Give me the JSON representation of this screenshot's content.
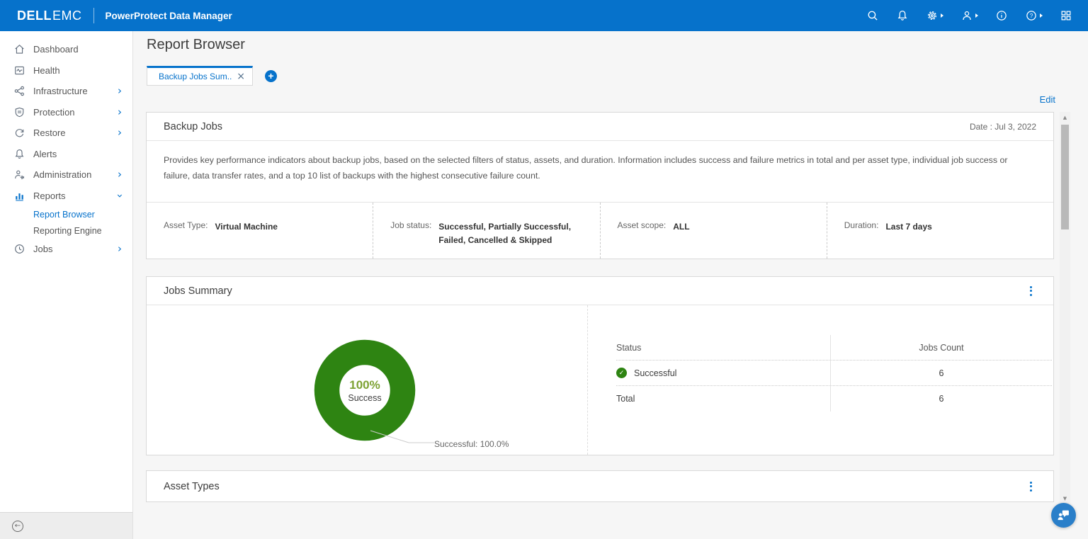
{
  "topbar": {
    "logo_primary": "DELL",
    "logo_secondary": "EMC",
    "app_title": "PowerProtect Data Manager"
  },
  "icons": {
    "chevron": "›",
    "close": "×",
    "plus": "+",
    "check": "✓",
    "question": "?",
    "collapse": "←",
    "scroll_up": "▲",
    "scroll_down": "▼"
  },
  "sidebar": {
    "items": [
      {
        "label": "Dashboard"
      },
      {
        "label": "Health"
      },
      {
        "label": "Infrastructure"
      },
      {
        "label": "Protection"
      },
      {
        "label": "Restore"
      },
      {
        "label": "Alerts"
      },
      {
        "label": "Administration"
      },
      {
        "label": "Reports"
      },
      {
        "label": "Jobs"
      }
    ],
    "reports_subitems": [
      {
        "label": "Report Browser"
      },
      {
        "label": "Reporting Engine"
      }
    ]
  },
  "page": {
    "title": "Report Browser",
    "edit_link": "Edit",
    "active_tab": "Backup Jobs Sum..."
  },
  "backup_jobs": {
    "title": "Backup Jobs",
    "date": "Date : Jul 3, 2022",
    "description": "Provides key performance indicators about backup jobs, based on the selected filters of status, assets, and duration. Information includes success and failure metrics in total and per asset type, individual job success or failure, data transfer rates, and a top 10 list of backups with the highest consecutive failure count.",
    "filters": [
      {
        "label": "Asset Type:",
        "value": "Virtual Machine"
      },
      {
        "label": "Job status:",
        "value": "Successful, Partially Successful, Failed, Cancelled & Skipped"
      },
      {
        "label": "Asset scope:",
        "value": "ALL"
      },
      {
        "label": "Duration:",
        "value": "Last 7 days"
      }
    ]
  },
  "jobs_summary": {
    "title": "Jobs Summary",
    "donut_center_value": "100%",
    "donut_center_label": "Success",
    "callout": "Successful: 100.0%",
    "table": {
      "headers": [
        "Status",
        "Jobs Count"
      ],
      "rows": [
        {
          "status": "Successful",
          "count": "6"
        },
        {
          "status": "Total",
          "count": "6"
        }
      ]
    }
  },
  "asset_types": {
    "title": "Asset Types"
  },
  "chart_data": {
    "type": "pie",
    "donut": true,
    "title": "Jobs Summary",
    "labels": [
      "Successful"
    ],
    "values": [
      100.0
    ],
    "unit": "%",
    "counts": [
      6
    ],
    "total_jobs": 6,
    "center_text": "100% Success",
    "annotation": "Successful: 100.0%",
    "colors": [
      "#2e8412"
    ],
    "legend_position": "none"
  },
  "colors": {
    "topbar_blue": "#0672cb",
    "accent_blue": "#0672cb",
    "success_green": "#2e8412",
    "center_percent_green": "#7da233"
  }
}
